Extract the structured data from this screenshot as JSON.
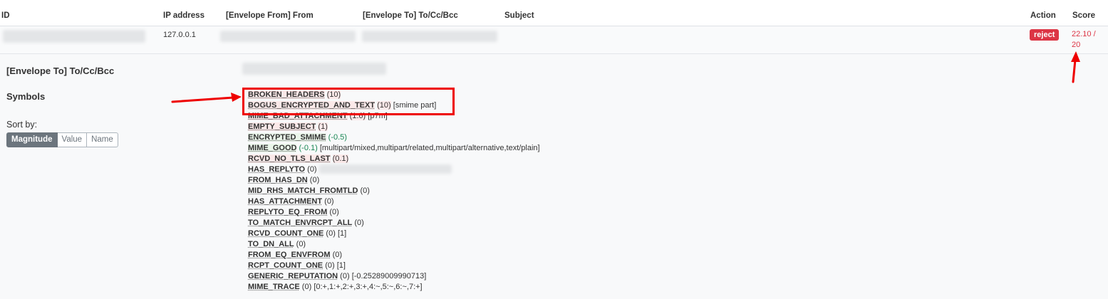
{
  "headers": {
    "id": "ID",
    "ip": "IP address",
    "from": "[Envelope From] From",
    "to": "[Envelope To] To/Cc/Bcc",
    "subject": "Subject",
    "action": "Action",
    "score": "Score"
  },
  "row": {
    "ip": "127.0.0.1",
    "action": "reject",
    "score": "22.10 / 20"
  },
  "detail": {
    "to_label": "[Envelope To] To/Cc/Bcc",
    "symbols_label": "Symbols",
    "sort_by": "Sort by:",
    "sort_buttons": [
      "Magnitude",
      "Value",
      "Name"
    ]
  },
  "symbols": [
    {
      "name": "BROKEN_HEADERS",
      "score": "(10)",
      "extra": "",
      "kind": "pos"
    },
    {
      "name": "BOGUS_ENCRYPTED_AND_TEXT",
      "score": "(10)",
      "extra": "[smime part]",
      "kind": "pos"
    },
    {
      "name": "MIME_BAD_ATTACHMENT",
      "score": "(1.6)",
      "extra": "[p7m]",
      "kind": "pos"
    },
    {
      "name": "EMPTY_SUBJECT",
      "score": "(1)",
      "extra": "",
      "kind": "pos"
    },
    {
      "name": "ENCRYPTED_SMIME",
      "score": "(-0.5)",
      "extra": "",
      "kind": "neg"
    },
    {
      "name": "MIME_GOOD",
      "score": "(-0.1)",
      "extra": "[multipart/mixed,multipart/related,multipart/alternative,text/plain]",
      "kind": "neg"
    },
    {
      "name": "RCVD_NO_TLS_LAST",
      "score": "(0.1)",
      "extra": "",
      "kind": "pos"
    },
    {
      "name": "HAS_REPLYTO",
      "score": "(0)",
      "extra": "",
      "kind": "zero"
    },
    {
      "name": "FROM_HAS_DN",
      "score": "(0)",
      "extra": "",
      "kind": "zero"
    },
    {
      "name": "MID_RHS_MATCH_FROMTLD",
      "score": "(0)",
      "extra": "",
      "kind": "zero"
    },
    {
      "name": "HAS_ATTACHMENT",
      "score": "(0)",
      "extra": "",
      "kind": "zero"
    },
    {
      "name": "REPLYTO_EQ_FROM",
      "score": "(0)",
      "extra": "",
      "kind": "zero"
    },
    {
      "name": "TO_MATCH_ENVRCPT_ALL",
      "score": "(0)",
      "extra": "",
      "kind": "zero"
    },
    {
      "name": "RCVD_COUNT_ONE",
      "score": "(0)",
      "extra": "[1]",
      "kind": "zero"
    },
    {
      "name": "TO_DN_ALL",
      "score": "(0)",
      "extra": "",
      "kind": "zero"
    },
    {
      "name": "FROM_EQ_ENVFROM",
      "score": "(0)",
      "extra": "",
      "kind": "zero"
    },
    {
      "name": "RCPT_COUNT_ONE",
      "score": "(0)",
      "extra": "[1]",
      "kind": "zero"
    },
    {
      "name": "GENERIC_REPUTATION",
      "score": "(0)",
      "extra": "[-0.25289009990713]",
      "kind": "zero"
    },
    {
      "name": "MIME_TRACE",
      "score": "(0)",
      "extra": "[0:+,1:+,2:+,3:+,4:~,5:~,6:~,7:+]",
      "kind": "zero"
    }
  ],
  "colors": {
    "reject": "#dc3545",
    "annotation": "#ee0000"
  }
}
